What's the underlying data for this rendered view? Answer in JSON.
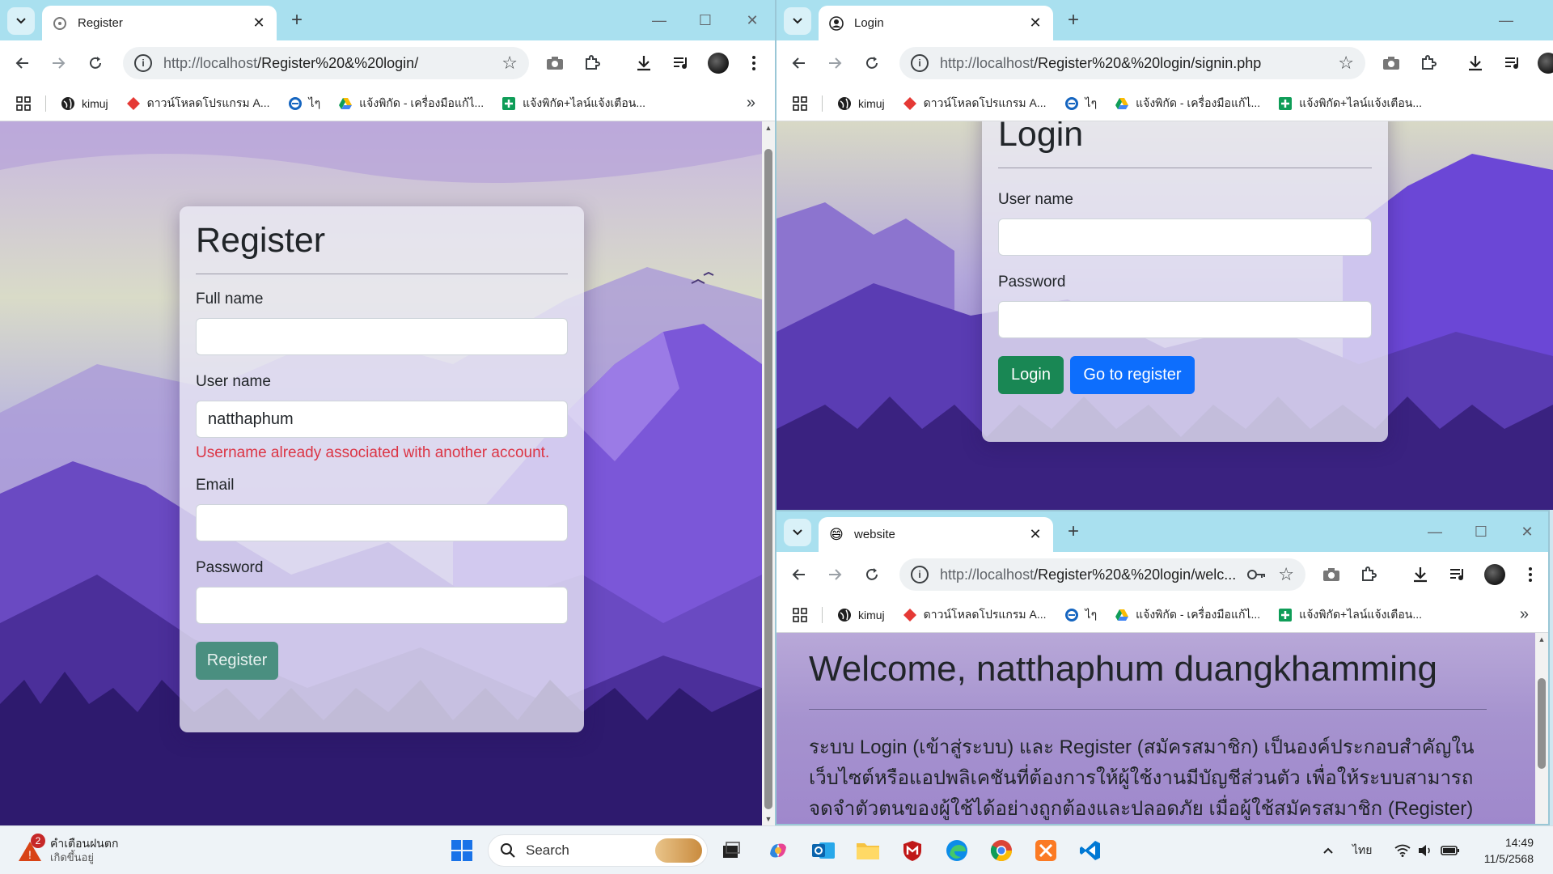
{
  "register_window": {
    "tab_title": "Register",
    "url_host": "http://localhost",
    "url_path": "/Register%20&%20login/",
    "form": {
      "heading": "Register",
      "fullname_label": "Full name",
      "fullname_value": "",
      "username_label": "User name",
      "username_value": "natthaphum",
      "username_error": "Username already associated with another account.",
      "email_label": "Email",
      "email_value": "",
      "password_label": "Password",
      "password_value": "",
      "submit_label": "Register"
    }
  },
  "login_window": {
    "tab_title": "Login",
    "url_host": "http://localhost",
    "url_path": "/Register%20&%20login/signin.php",
    "form": {
      "heading": "Login",
      "username_label": "User name",
      "password_label": "Password",
      "login_label": "Login",
      "register_label": "Go to register"
    }
  },
  "welcome_window": {
    "tab_title": "website",
    "tab_icon": "😄",
    "url_host": "http://localhost",
    "url_path": "/Register%20&%20login/welc...",
    "heading": "Welcome, natthaphum duangkhamming",
    "body": "ระบบ Login (เข้าสู่ระบบ) และ Register (สมัครสมาชิก) เป็นองค์ประกอบสำคัญในเว็บไซต์หรือแอปพลิเคชันที่ต้องการให้ผู้ใช้งานมีบัญชีส่วนตัว เพื่อให้ระบบสามารถจดจำตัวตนของผู้ใช้ได้อย่างถูกต้องและปลอดภัย เมื่อผู้ใช้สมัครสมาชิก (Register) ต้องกรอกข้อมูลที่จำเป็น เช่น ชื่อผู้ใช้ อีเมล และรหัสผ่าน"
  },
  "bookmarks": [
    {
      "label": "kimuj",
      "icon": "globe-icon"
    },
    {
      "label": "ดาวน์โหลดโปรแกรม A...",
      "icon": "diamond-icon"
    },
    {
      "label": "ไๆ",
      "icon": "circle-icon"
    },
    {
      "label": "แจ้งพิกัด - เครื่องมือแก้ไ...",
      "icon": "drive-icon"
    },
    {
      "label": "แจ้งพิกัด+ไลน์แจ้งเตือน...",
      "icon": "sheets-icon"
    }
  ],
  "taskbar": {
    "weather_badge": "2",
    "weather_title": "คำเตือนฝนตก",
    "weather_sub": "เกิดขึ้นอยู่",
    "search_placeholder": "Search",
    "language": "ไทย",
    "time": "14:49",
    "date": "11/5/2568"
  },
  "colors": {
    "tabstrip": "#a9e0ef",
    "green_button": "#198754",
    "blue_button": "#0d6efd",
    "error_text": "#dc3545"
  }
}
